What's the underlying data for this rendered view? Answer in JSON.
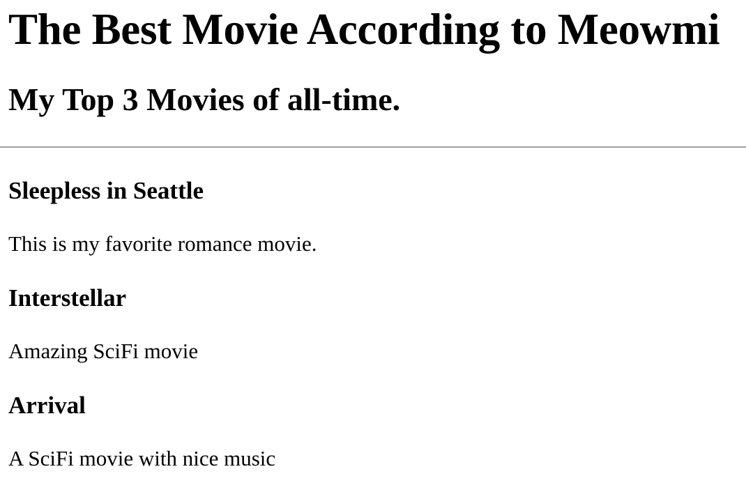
{
  "page": {
    "title": "The Best Movie According to Meowmi",
    "subtitle": "My Top 3 Movies of all-time."
  },
  "movies": [
    {
      "title": "Sleepless in Seattle",
      "description": "This is my favorite romance movie."
    },
    {
      "title": "Interstellar",
      "description": "Amazing SciFi movie"
    },
    {
      "title": "Arrival",
      "description": "A SciFi movie with nice music"
    }
  ]
}
